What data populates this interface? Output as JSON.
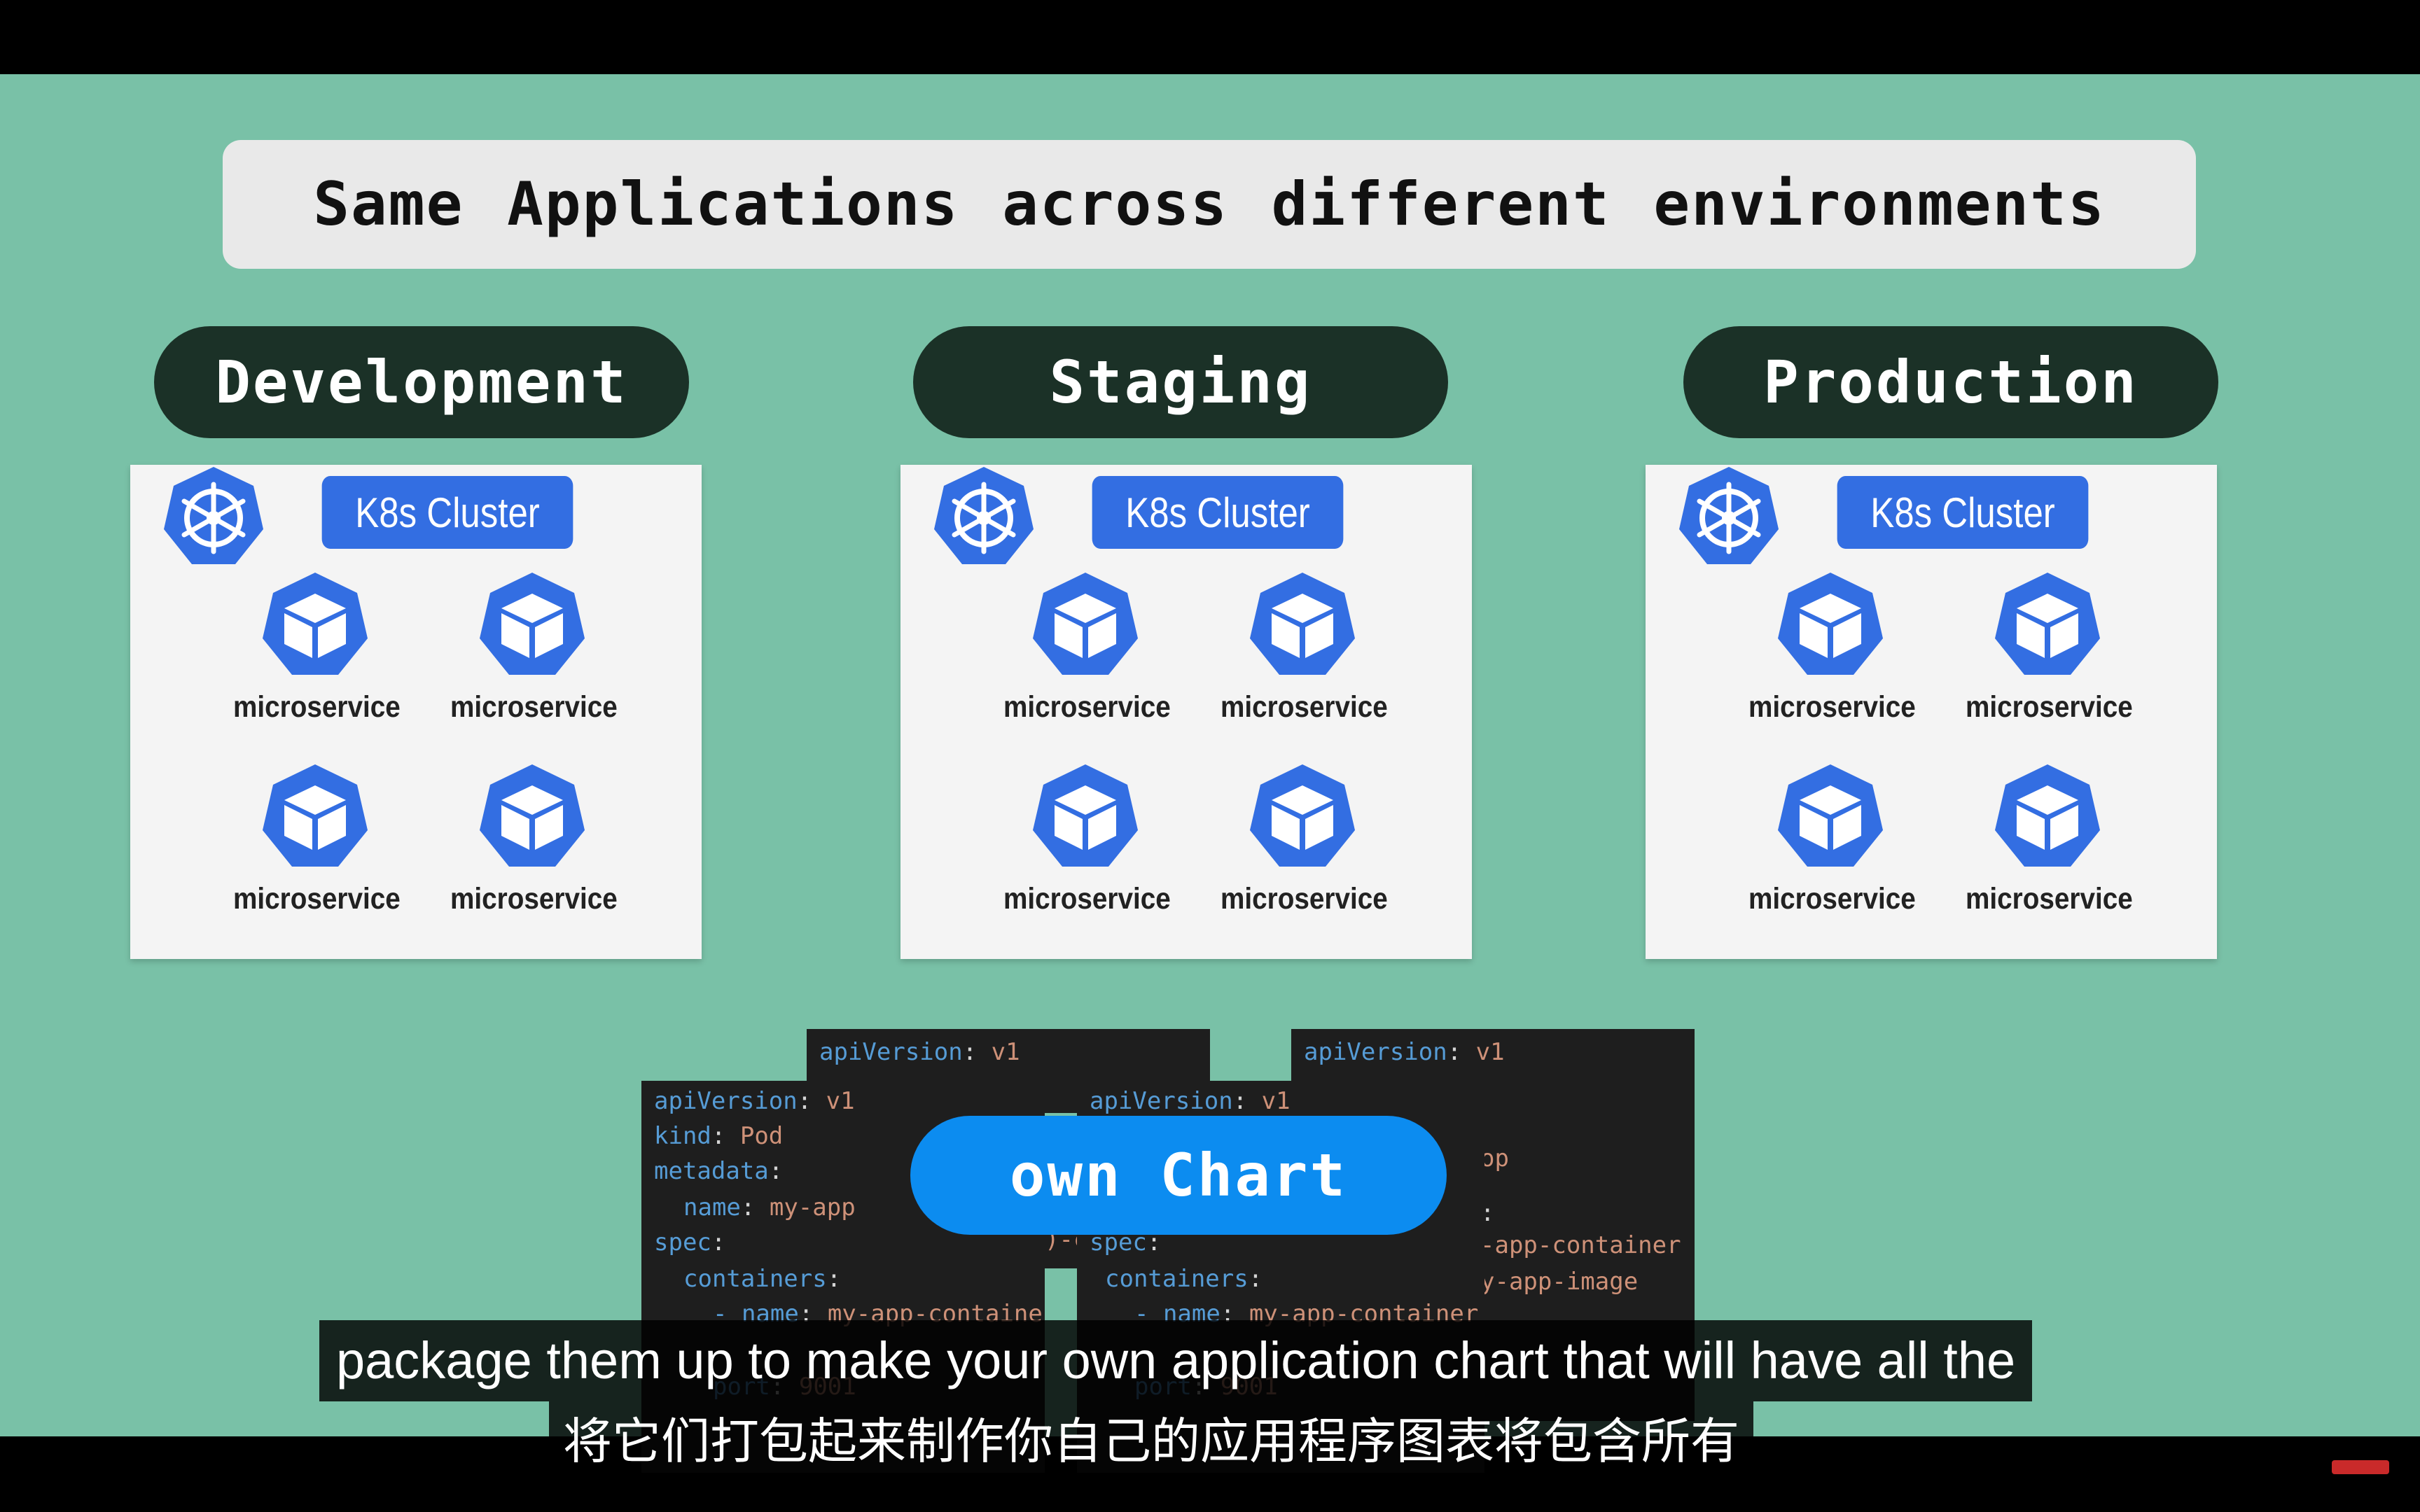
{
  "title": "Same Applications across different environments",
  "environments": [
    {
      "name": "Development",
      "cluster_label": "K8s Cluster",
      "services": [
        "microservice",
        "microservice",
        "microservice",
        "microservice"
      ]
    },
    {
      "name": "Staging",
      "cluster_label": "K8s Cluster",
      "services": [
        "microservice",
        "microservice",
        "microservice",
        "microservice"
      ]
    },
    {
      "name": "Production",
      "cluster_label": "K8s Cluster",
      "services": [
        "microservice",
        "microservice",
        "microservice",
        "microservice"
      ]
    }
  ],
  "yaml": {
    "api_key": "apiVersion",
    "api_val": "v1",
    "kind_key": "kind",
    "kind_val": "Pod",
    "meta_key": "metadata",
    "name_key": "name",
    "name_val": "my-app",
    "spec_key": "spec",
    "containers_key": "containers",
    "cname_val": "my-app-container",
    "image_frag": "y-app-image",
    "container_frag": "-app-container",
    "port_key": "port",
    "port_val": "9001",
    "frag_op": "op",
    "frag_c": ")-c",
    "frag_p": "op-",
    "colon": ":"
  },
  "chart_label": "own Chart",
  "subtitles": {
    "english": "package them up to make your own application chart that will have all the",
    "chinese": "将它们打包起来制作你自己的应用程序图表将包含所有"
  },
  "colors": {
    "background": "#79c1a7",
    "env_pill": "#1b3127",
    "k8s_blue": "#336ee2",
    "chart_pill": "#0c8cf0"
  }
}
